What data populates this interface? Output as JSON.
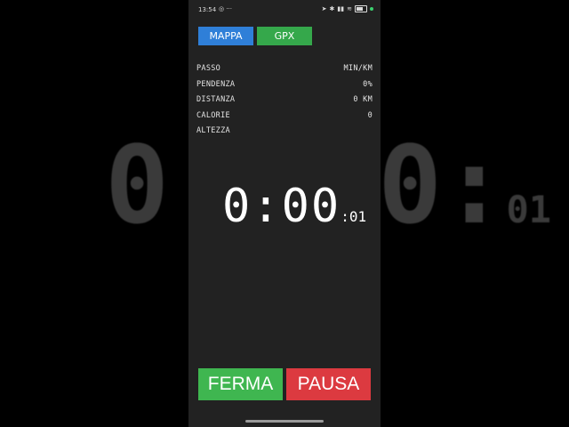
{
  "background_echo": {
    "left_digit": "0",
    "right_text": "0:",
    "right_small": "01"
  },
  "status_bar": {
    "time": "13:54",
    "left_icons": "◎ ···"
  },
  "top_buttons": {
    "mappa": "MAPPA",
    "gpx": "GPX"
  },
  "stats": [
    {
      "label": "PASSO",
      "value": "MIN/KM"
    },
    {
      "label": "PENDENZA",
      "value": "0%"
    },
    {
      "label": "DISTANZA",
      "value": "0 KM"
    },
    {
      "label": "CALORIE",
      "value": "0"
    },
    {
      "label": "ALTEZZA",
      "value": ""
    }
  ],
  "timer": {
    "main": "0:00",
    "seconds": ":01"
  },
  "bottom_buttons": {
    "ferma": "FERMA",
    "pausa": "PAUSA"
  },
  "colors": {
    "mappa": "#2f7fd8",
    "gpx": "#35a84b",
    "ferma": "#3fb650",
    "pausa": "#dc3a40",
    "screen_bg": "#222222"
  }
}
